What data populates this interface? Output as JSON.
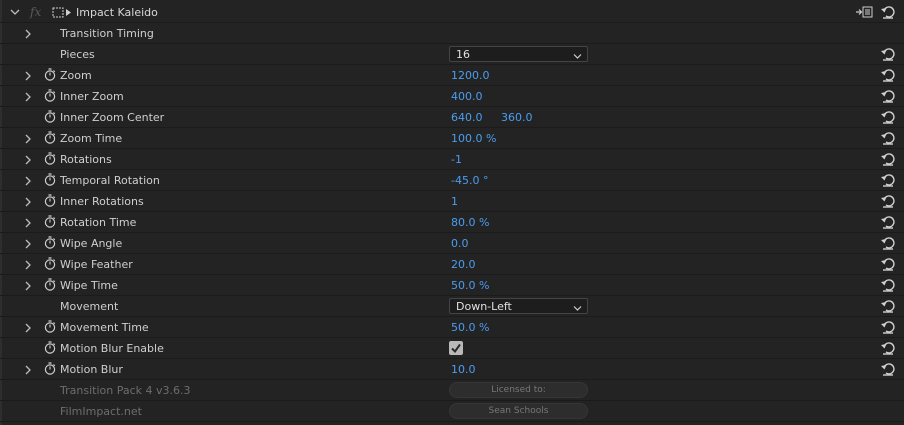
{
  "effect": {
    "fx_label": "fx",
    "title": "Impact Kaleido"
  },
  "params": [
    {
      "label": "Transition Timing"
    },
    {
      "label": "Pieces",
      "value": "16"
    },
    {
      "label": "Zoom",
      "value": "1200.0"
    },
    {
      "label": "Inner Zoom",
      "value": "400.0"
    },
    {
      "label": "Inner Zoom Center",
      "value": "640.0",
      "value2": "360.0"
    },
    {
      "label": "Zoom Time",
      "value": "100.0 %"
    },
    {
      "label": "Rotations",
      "value": "-1"
    },
    {
      "label": "Temporal Rotation",
      "value": "-45.0 °"
    },
    {
      "label": "Inner Rotations",
      "value": "1"
    },
    {
      "label": "Rotation Time",
      "value": "80.0 %"
    },
    {
      "label": "Wipe Angle",
      "value": "0.0"
    },
    {
      "label": "Wipe Feather",
      "value": "20.0"
    },
    {
      "label": "Wipe Time",
      "value": "50.0 %"
    },
    {
      "label": "Movement",
      "value": "Down-Left"
    },
    {
      "label": "Movement Time",
      "value": "50.0 %"
    },
    {
      "label": "Motion Blur Enable",
      "checked": true
    },
    {
      "label": "Motion Blur",
      "value": "10.0"
    },
    {
      "label": "Transition Pack 4 v3.6.3",
      "button": "Licensed to:"
    },
    {
      "label": "FilmImpact.net",
      "button": "Sean Schools"
    }
  ],
  "colors": {
    "value_blue": "#4b9df0",
    "background": "#232323"
  }
}
